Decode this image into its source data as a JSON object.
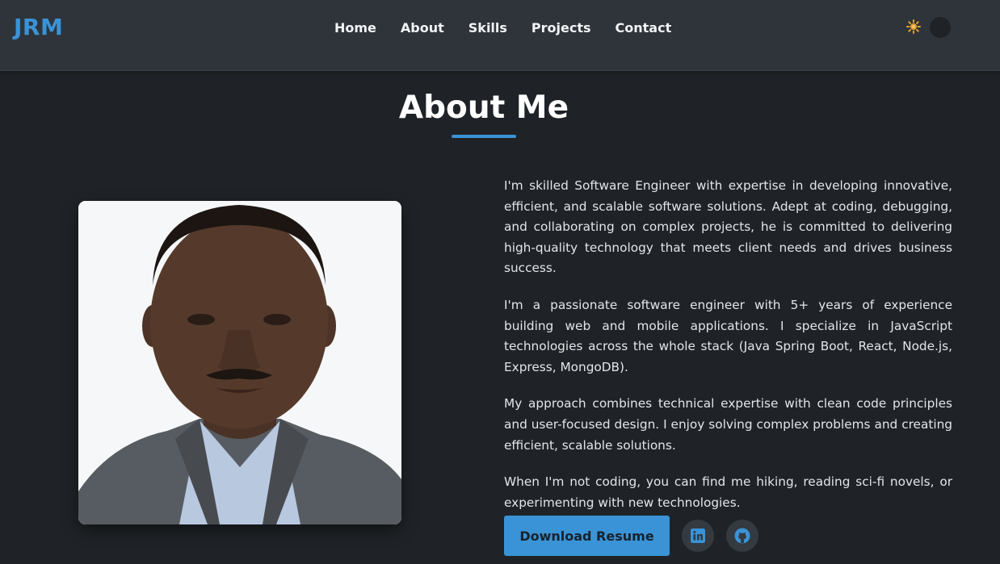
{
  "header": {
    "logo": "JRM",
    "nav": [
      "Home",
      "About",
      "Skills",
      "Projects",
      "Contact"
    ],
    "theme_icon": "sun-icon"
  },
  "about": {
    "title": "About Me",
    "photo_icon": "profile-photo",
    "paragraphs": [
      "I'm skilled Software Engineer with expertise in developing innovative, efficient, and scalable software solutions. Adept at coding, debugging, and collaborating on complex projects, he is committed to delivering high-quality technology that meets client needs and drives business success.",
      "I'm a passionate software engineer with 5+ years of experience building web and mobile applications. I specialize in JavaScript technologies across the whole stack (Java Spring Boot, React, Node.js, Express, MongoDB).",
      "My approach combines technical expertise with clean code principles and user-focused design. I enjoy solving complex problems and creating efficient, scalable solutions.",
      "When I'm not coding, you can find me hiking, reading sci-fi novels, or experimenting with new technologies."
    ],
    "resume_label": "Download Resume",
    "social_icons": [
      "linkedin-icon",
      "github-icon"
    ]
  },
  "colors": {
    "accent": "#3a93d6",
    "background": "#1f2327",
    "navbar": "#2f343a",
    "sun": "#e0a030"
  }
}
